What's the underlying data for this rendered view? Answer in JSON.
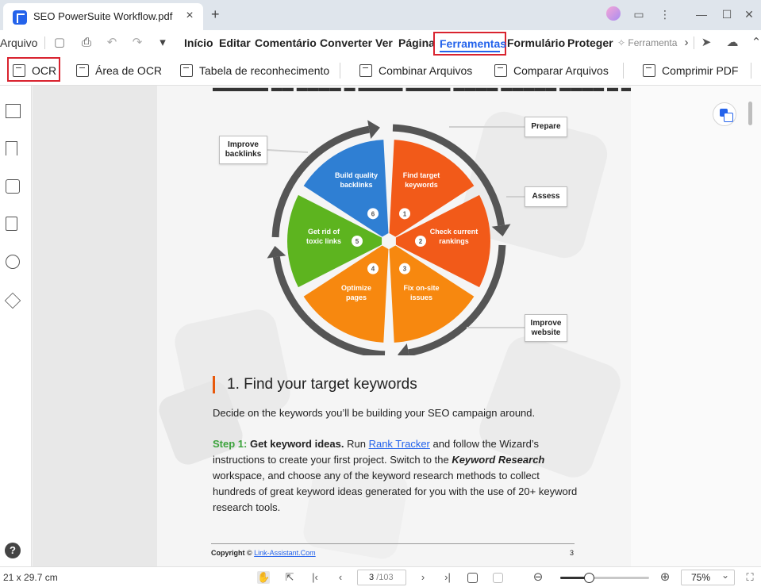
{
  "titlebar": {
    "tab_title": "SEO PowerSuite Workflow.pdf",
    "close_glyph": "×",
    "new_tab_glyph": "+",
    "message_glyph": "▭",
    "more_glyph": "⋮",
    "minimize_glyph": "—",
    "maximize_glyph": "☐",
    "close_window_glyph": "✕"
  },
  "menubar": {
    "file": "Arquivo",
    "items": [
      "Início",
      "Editar",
      "Comentário",
      "Converter",
      "Ver",
      "Página"
    ],
    "active": "Ferramentas",
    "items_after": [
      "Formulário",
      "Proteger"
    ],
    "search_hint": "Ferramenta",
    "chevron_right": "›",
    "save_glyph": "▢",
    "print_glyph": "⎙",
    "undo_glyph": "↶",
    "redo_glyph": "↷",
    "dropdown_glyph": "▾",
    "send_glyph": "➤",
    "cloud_glyph": "☁",
    "collapse_glyph": "⌃"
  },
  "ribbon": {
    "ocr": "OCR",
    "ocr_area": "Área de OCR",
    "recognition_table": "Tabela de reconhecimento",
    "combine": "Combinar Arquivos",
    "compare": "Comparar Arquivos",
    "compress": "Comprimir PDF"
  },
  "document": {
    "wheel": {
      "segments": [
        {
          "label": "Find target keywords",
          "number": "1",
          "color": "#f25a19"
        },
        {
          "label": "Check current rankings",
          "number": "2",
          "color": "#f25a19"
        },
        {
          "label": "Fix on-site issues",
          "number": "3",
          "color": "#f7880f"
        },
        {
          "label": "Optimize pages",
          "number": "4",
          "color": "#f7880f"
        },
        {
          "label": "Get rid of toxic links",
          "number": "5",
          "color": "#5db41f"
        },
        {
          "label": "Build quality backlinks",
          "number": "6",
          "color": "#2f7fd3"
        }
      ],
      "ring_color": "#555555"
    },
    "callouts": {
      "prepare": "Prepare",
      "assess": "Assess",
      "improve_website": "Improve website",
      "improve_backlinks": "Improve backlinks"
    },
    "section_title": "1. Find your target keywords",
    "intro": "Decide on the keywords you’ll be building your SEO campaign around.",
    "step_label": "Step 1:",
    "step_bold": "Get keyword ideas.",
    "step_run": "Run",
    "rank_tracker": "Rank Tracker",
    "step_rest1": "and follow the Wizard’s",
    "line2_a": "instructions to create your first project. Switch to the",
    "line2_b": "Keyword Research",
    "line3": "workspace, and choose any of the keyword research methods to collect",
    "line4": "hundreds of great keyword ideas generated for you with the use of 20+ keyword",
    "line5": "research tools.",
    "footer_copyright": "Copyright ©",
    "footer_link": "Link-Assistant.Com",
    "footer_page": "3"
  },
  "statusbar": {
    "page_size": "21 x 29.7 cm",
    "current_page": "3",
    "total_pages": "/103",
    "zoom": "75%",
    "zoom_fraction": 0.32,
    "hand_glyph": "✋",
    "select_glyph": "⇱",
    "first_glyph": "|‹",
    "prev_glyph": "‹",
    "next_glyph": "›",
    "last_glyph": "›|",
    "zoom_out_glyph": "⊖",
    "zoom_in_glyph": "⊕",
    "fit_glyph": "⛶"
  }
}
